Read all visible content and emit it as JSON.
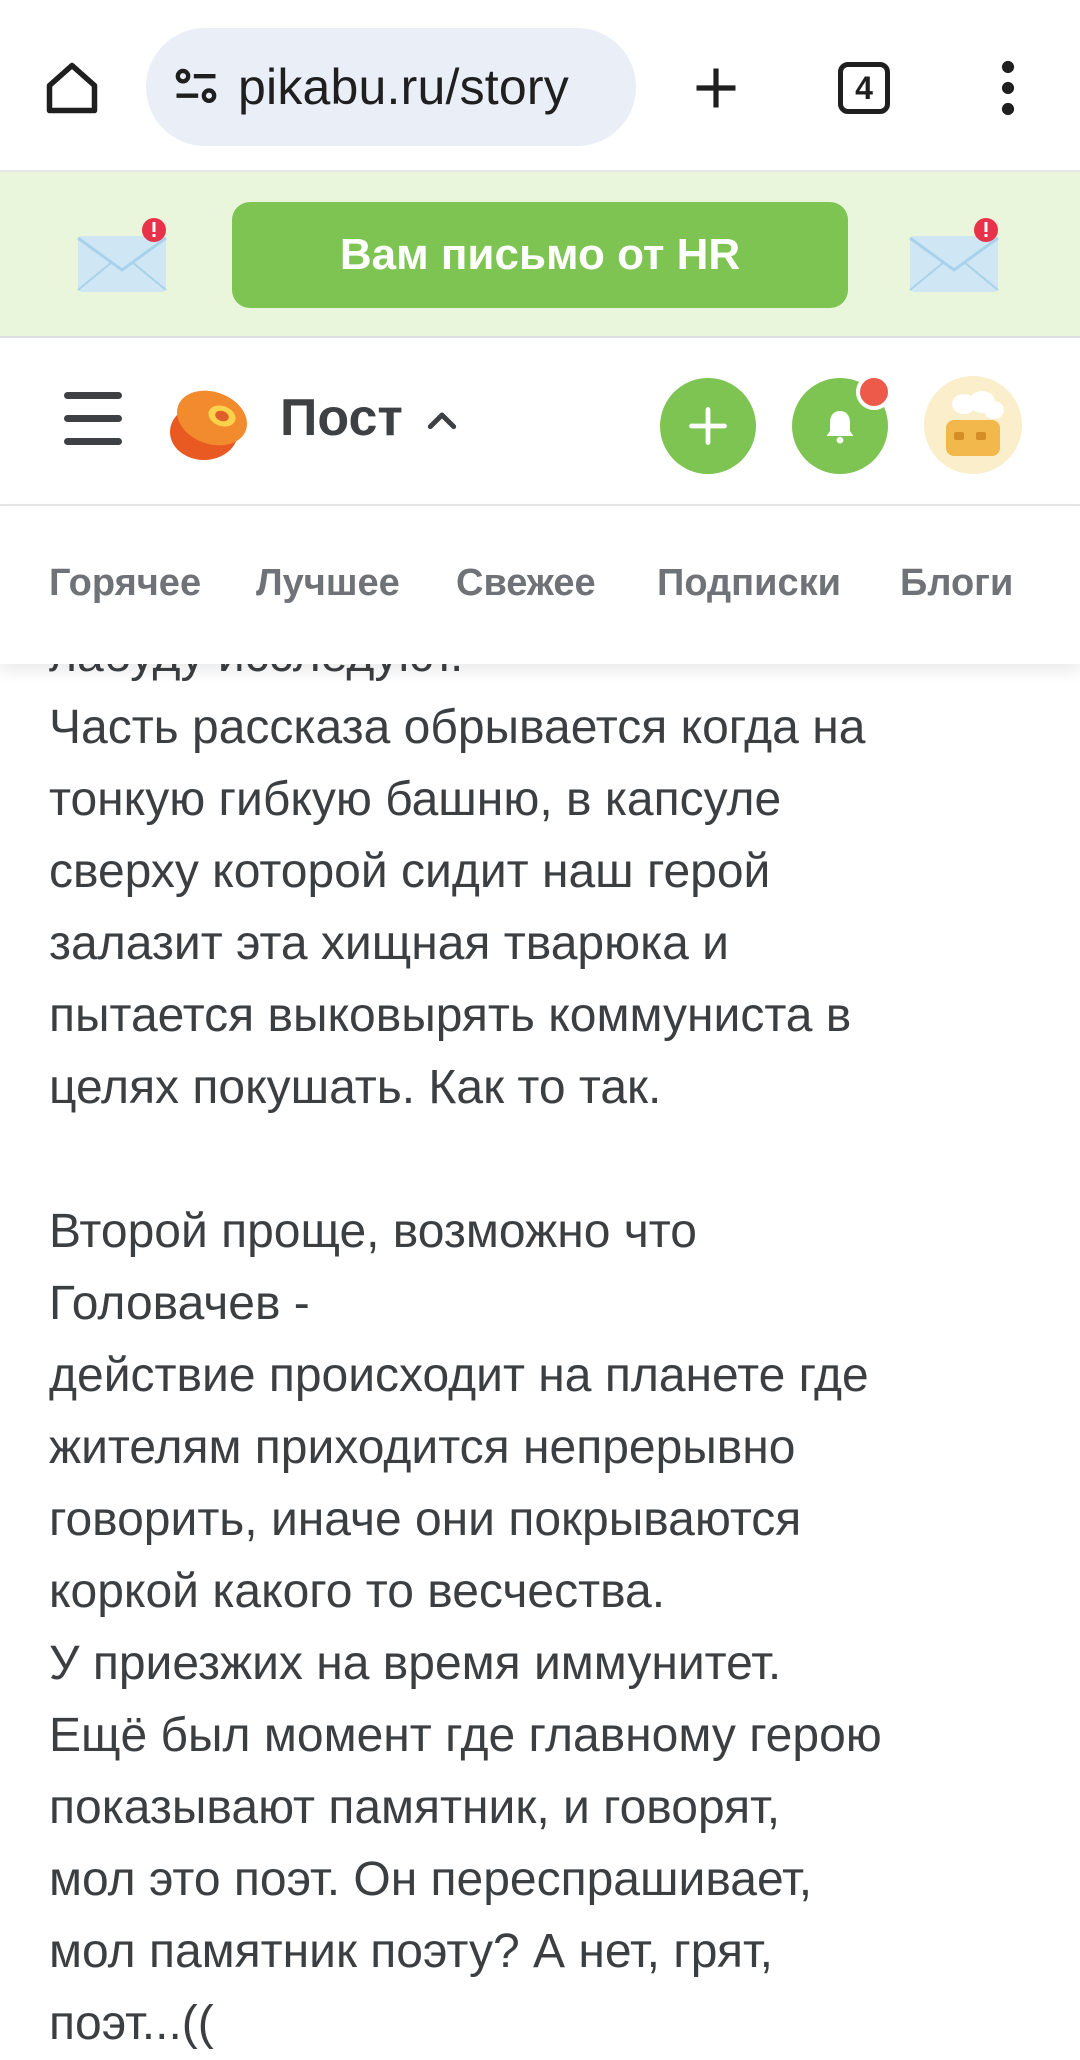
{
  "browser": {
    "url": "pikabu.ru/story",
    "tab_count": "4"
  },
  "promo": {
    "button_label": "Вам письмо от HR"
  },
  "header": {
    "title": "Пост"
  },
  "nav": {
    "items": [
      "Горячее",
      "Лучшее",
      "Свежее",
      "Подписки",
      "Блоги"
    ]
  },
  "article": {
    "clipped_line": "лабуду исследуют.",
    "paragraph1": [
      "Часть рассказа обрывается когда на",
      "тонкую гибкую башню, в капсуле",
      "сверху которой сидит наш герой",
      "залазит эта хищная тварюка и",
      "пытается выковырять коммуниста в",
      "целях покушать. Как то так."
    ],
    "paragraph2": [
      "Второй проще, возможно что",
      "Головачев -",
      "действие происходит на планете где",
      "жителям приходится непрерывно",
      "говорить, иначе они покрываются",
      "коркой какого то весчества.",
      "У приезжих на время иммунитет.",
      "Ещё был момент где главному герою",
      "показывают памятник, и говорят,",
      "мол это поэт. Он переспрашивает,",
      "мол памятник поэту? А нет, грят,",
      "поэт...(("
    ]
  },
  "colors": {
    "accent_green": "#7dc453",
    "promo_bg": "#eaf6dc",
    "notification_red": "#ee5a4a",
    "text": "#3c3f42"
  },
  "icons": [
    "home-icon",
    "site-settings-icon",
    "new-tab-icon",
    "tabs-icon",
    "more-menu-icon",
    "envelope-icon",
    "hamburger-icon",
    "pikabu-logo",
    "chevron-up-icon",
    "plus-icon",
    "bell-icon",
    "avatar"
  ]
}
